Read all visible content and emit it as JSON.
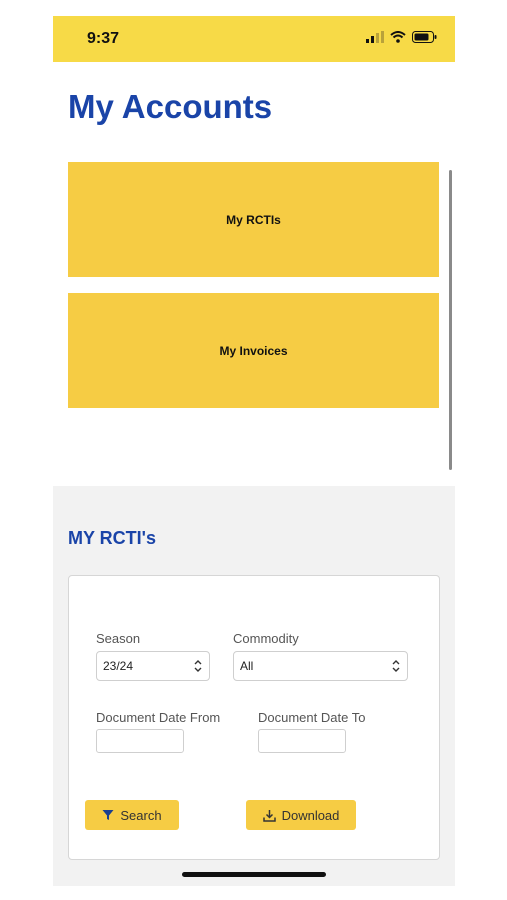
{
  "status_bar": {
    "time": "9:37",
    "icons": [
      "signal-icon",
      "wifi-icon",
      "battery-icon"
    ],
    "background": "#f7da47"
  },
  "page": {
    "title": "My Accounts"
  },
  "tiles": [
    {
      "label": "My RCTIs"
    },
    {
      "label": "My Invoices"
    }
  ],
  "rcti": {
    "title": "MY RCTI's",
    "season": {
      "label": "Season",
      "value": "23/24"
    },
    "commodity": {
      "label": "Commodity",
      "value": "All"
    },
    "date_from": {
      "label": "Document Date From",
      "value": ""
    },
    "date_to": {
      "label": "Document Date To",
      "value": ""
    },
    "search_label": "Search",
    "download_label": "Download"
  },
  "colors": {
    "accent_yellow": "#f6cc44",
    "title_blue": "#1a44a8"
  }
}
